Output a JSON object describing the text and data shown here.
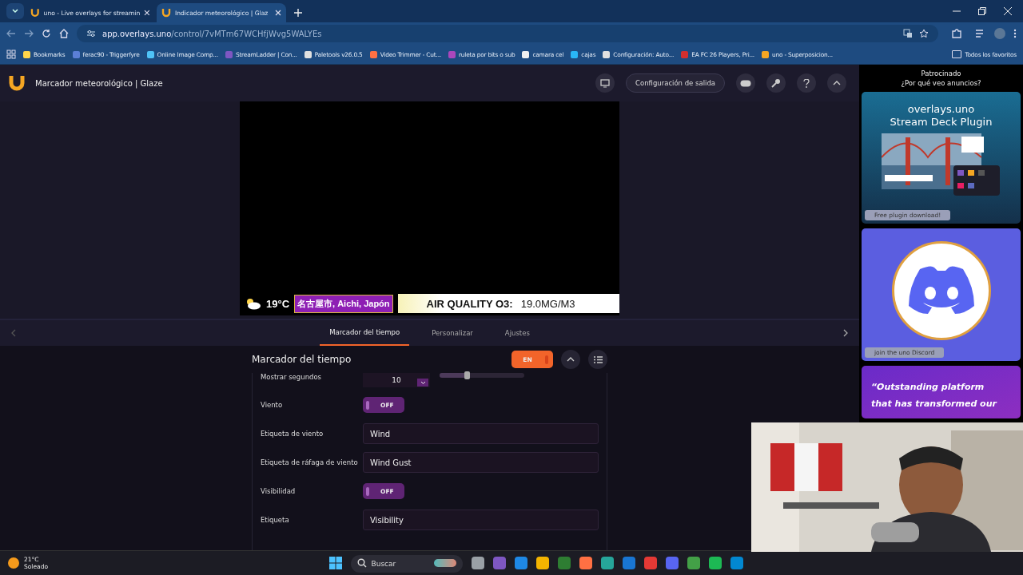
{
  "browser": {
    "tabs": [
      {
        "title": "uno - Live overlays for streamin",
        "selected": false
      },
      {
        "title": "Indicador meteorológico | Glaz",
        "selected": true
      }
    ],
    "url_host": "app.overlays.uno",
    "url_path": "/control/7vMTm67WCHfjWvg5WALYEs",
    "bookmarks": [
      "Bookmarks",
      "ferac90 - Triggerfyre",
      "Online Image Comp...",
      "StreamLadder | Con...",
      "Paletools v26.0.5",
      "Video Trimmer - Cut...",
      "ruleta por bits o sub",
      "camara cel",
      "cajas",
      "Configuración: Auto...",
      "EA FC 26 Players, Pri...",
      "uno - Superposicion..."
    ],
    "all_bookmarks": "Todos los favoritos"
  },
  "app": {
    "title": "Marcador meteorológico | Glaze",
    "output_button": "Configuración de salida"
  },
  "preview": {
    "temperature": "19°C",
    "location": "名古屋市, Aichi, Japón",
    "metric_label": "AIR QUALITY O3:",
    "metric_value": "19.0MG/M3"
  },
  "panel_tabs": [
    {
      "label": "Marcador del tiempo",
      "selected": true
    },
    {
      "label": "Personalizar",
      "selected": false
    },
    {
      "label": "Ajustes",
      "selected": false
    }
  ],
  "section": {
    "title": "Marcador del tiempo",
    "toggle": {
      "label": "EN",
      "on": true
    }
  },
  "rows": [
    {
      "kind": "number",
      "label": "Mostrar segundos",
      "value": "10",
      "level": 0.33
    },
    {
      "kind": "toggle",
      "label": "Viento",
      "text": "OFF",
      "on": false
    },
    {
      "kind": "text",
      "label": "Etiqueta de viento",
      "value": "Wind"
    },
    {
      "kind": "text",
      "label": "Etiqueta de ráfaga de viento",
      "value": "Wind Gust"
    },
    {
      "kind": "toggle",
      "label": "Visibilidad",
      "text": "OFF",
      "on": false
    },
    {
      "kind": "text",
      "label": "Etiqueta",
      "value": "Visibility"
    }
  ],
  "ads": {
    "sponsored": "Patrocinado",
    "why": "¿Por qué veo anuncios?",
    "plugin_title": [
      "overlays.uno",
      "Stream Deck Plugin"
    ],
    "plugin_button": "Free plugin download!",
    "discord_button": "join the uno Discord",
    "quote": [
      "“Outstanding platform",
      "that has transformed our"
    ]
  },
  "taskbar": {
    "temperature": "21°C",
    "weather": "Soleado",
    "search_placeholder": "Buscar"
  }
}
